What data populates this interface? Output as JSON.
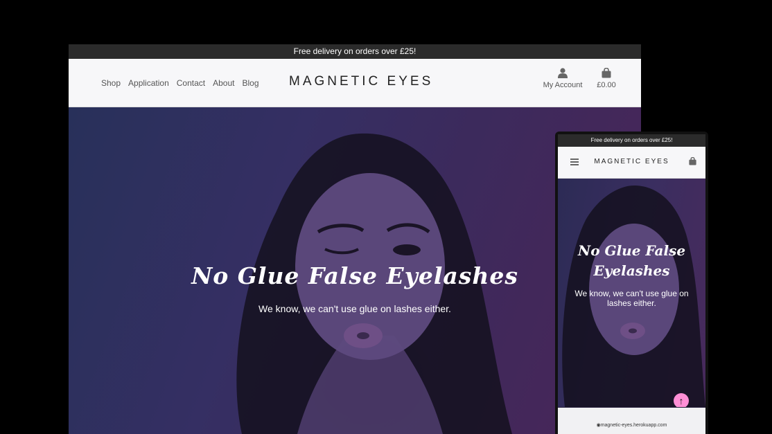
{
  "desktop": {
    "promo_text": "Free delivery on orders over £25!",
    "nav": {
      "shop": "Shop",
      "application": "Application",
      "contact": "Contact",
      "about": "About",
      "blog": "Blog"
    },
    "logo": "MAGNETIC EYES",
    "account_label": "My Account",
    "bag_total": "£0.00",
    "hero_title": "No Glue False Eyelashes",
    "hero_subtitle": "We know, we can't use glue on lashes either."
  },
  "mobile": {
    "promo_text": "Free delivery on orders over £25!",
    "logo": "MAGNETIC EYES",
    "hero_title_line1": "No Glue False",
    "hero_title_line2": "Eyelashes",
    "hero_subtitle": "We know, we can't use glue on lashes either.",
    "url": "magnetic-eyes.herokuapp.com"
  },
  "icons": [
    "user-icon",
    "shopping-bag-icon",
    "hamburger-menu-icon",
    "arrow-up-icon",
    "lock-icon"
  ],
  "colors": {
    "page_background": "#000000",
    "promo_bar": "#2b2b2b",
    "header_background": "#f7f7f9",
    "hero_overlay_purple": "#3c2a5c",
    "back_to_top": "#ff8fd6"
  }
}
